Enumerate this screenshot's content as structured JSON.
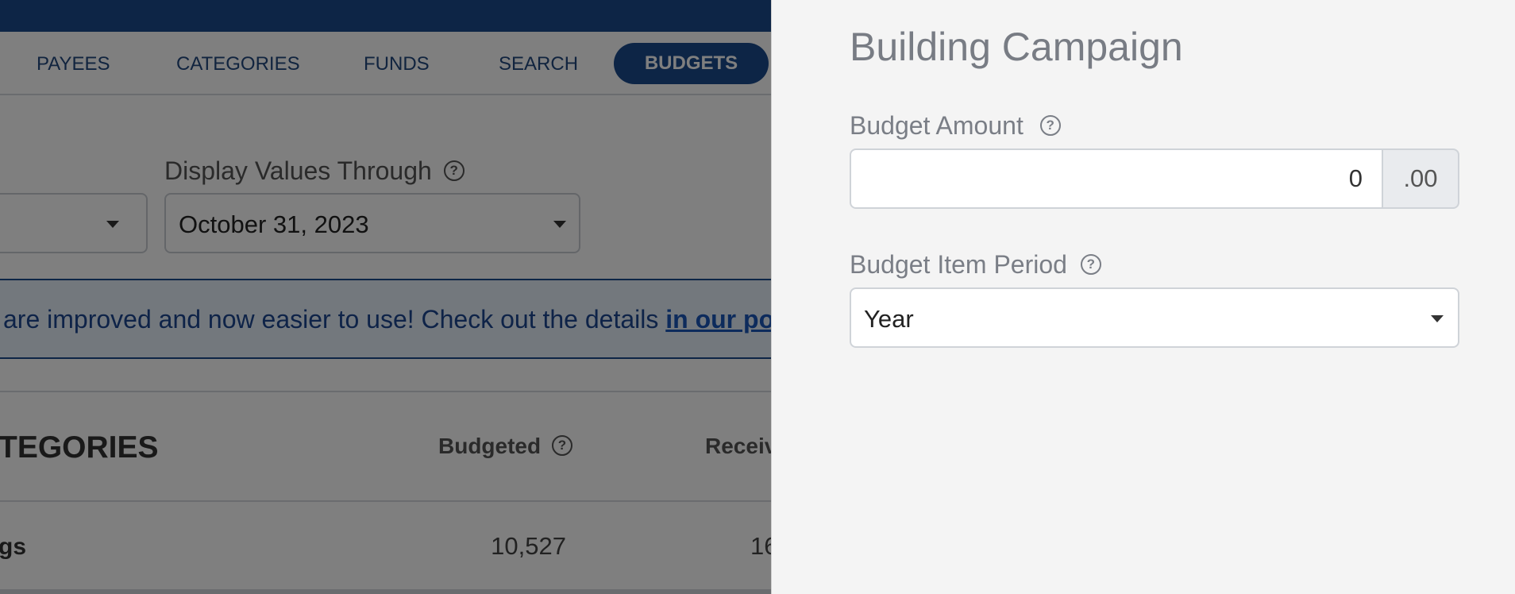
{
  "nav": {
    "items": [
      "PAYEES",
      "CATEGORIES",
      "FUNDS",
      "SEARCH"
    ],
    "active": "BUDGETS"
  },
  "filters": {
    "display_through_label": "Display Values Through",
    "display_through_value": "October 31, 2023"
  },
  "banner": {
    "text": "are improved and now easier to use! Check out the details ",
    "link": "in our post"
  },
  "table": {
    "title": "TEGORIES",
    "budgeted_header": "Budgeted",
    "received_header": "Received",
    "row_label": "gs",
    "row_budgeted": "10,527",
    "row_received": "16"
  },
  "panel": {
    "title": "Building Campaign",
    "budget_amount_label": "Budget Amount",
    "budget_amount_value": "0",
    "budget_amount_cents": ".00",
    "period_label": "Budget Item Period",
    "period_value": "Year"
  },
  "icons": {
    "help": "?"
  },
  "colors": {
    "brand_navy": "#1b4a8c",
    "panel_bg": "#f4f4f4",
    "link": "#1a56b8"
  }
}
